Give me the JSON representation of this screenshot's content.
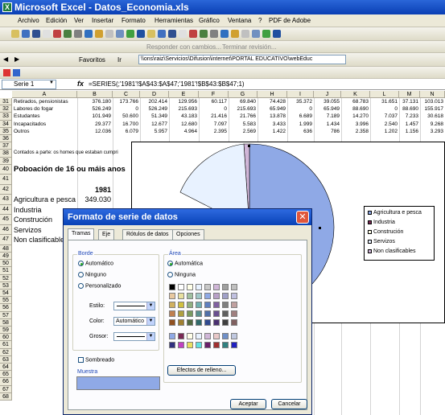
{
  "window": {
    "title": "Microsoft Excel - Datos_Economia.xls"
  },
  "menu": [
    "Archivo",
    "Edición",
    "Ver",
    "Insertar",
    "Formato",
    "Herramientas",
    "Gráfico",
    "Ventana",
    "?",
    "PDF de Adobe"
  ],
  "toolbar": {
    "reply_text": "Responder con cambios...",
    "end_review": "Terminar revisión...",
    "favorites": "Favoritos",
    "go": "Ir",
    "address": "\\\\ons\\raiz\\Servicios\\Difusion\\internet\\PORTAL EDUCATIVO\\webEduc"
  },
  "formula_bar": {
    "name_box": "Serie 1",
    "fx": "fx",
    "formula": "=SERIES(;'1981'!$A$43:$A$47;'1981'!$B$43:$B$47;1)"
  },
  "columns": [
    "A",
    "B",
    "C",
    "D",
    "E",
    "F",
    "G",
    "H",
    "I",
    "J",
    "K",
    "L",
    "M",
    "N"
  ],
  "rows": [
    {
      "num": "31",
      "label": "Retirados, pensionistas",
      "vals": [
        "376.180",
        "173.766",
        "202.414",
        "129.956",
        "60.117",
        "69.840",
        "74.428",
        "35.372",
        "39.055",
        "68.783",
        "31.651",
        "37.131",
        "103.013"
      ]
    },
    {
      "num": "32",
      "label": "Labores do fogar",
      "vals": [
        "526.249",
        "0",
        "526.249",
        "215.693",
        "0",
        "215.693",
        "65.949",
        "0",
        "65.949",
        "88.690",
        "0",
        "88.690",
        "155.917"
      ]
    },
    {
      "num": "33",
      "label": "Estudantes",
      "vals": [
        "101.949",
        "50.600",
        "51.349",
        "43.183",
        "21.416",
        "21.766",
        "13.878",
        "6.689",
        "7.189",
        "14.270",
        "7.037",
        "7.233",
        "30.618"
      ]
    },
    {
      "num": "34",
      "label": "Incapacitados",
      "vals": [
        "29.377",
        "16.700",
        "12.677",
        "12.680",
        "7.097",
        "5.583",
        "3.433",
        "1.999",
        "1.434",
        "3.996",
        "2.540",
        "1.457",
        "9.268"
      ]
    },
    {
      "num": "35",
      "label": "Outros",
      "vals": [
        "12.036",
        "6.079",
        "5.957",
        "4.964",
        "2.395",
        "2.569",
        "1.422",
        "636",
        "786",
        "2.358",
        "1.202",
        "1.156",
        "3.293"
      ]
    }
  ],
  "note_row": {
    "num": "38",
    "text": "Contados a parte: os homes que estaban cumpri"
  },
  "section_title": {
    "num": "40",
    "text": "Poboación de 16 ou máis anos"
  },
  "year_header": {
    "num": "42",
    "text": "1981"
  },
  "sector_rows": [
    {
      "num": "43",
      "label": "Agricultura e pesca",
      "value": "349.030"
    },
    {
      "num": "44",
      "label": "Industria",
      "value": ""
    },
    {
      "num": "45",
      "label": "Construción",
      "value": ""
    },
    {
      "num": "46",
      "label": "Servizos",
      "value": ""
    },
    {
      "num": "47",
      "label": "Non clasificable",
      "value": ""
    }
  ],
  "extra_row_nums": [
    "36",
    "37",
    "39",
    "41",
    "48",
    "49",
    "50",
    "51",
    "52",
    "53",
    "54",
    "55",
    "56",
    "57",
    "58",
    "59",
    "60",
    "61",
    "62",
    "63",
    "64",
    "65",
    "66",
    "67",
    "68"
  ],
  "chart_legend": [
    {
      "label": "Agricultura e pesca",
      "color": "#8fa9e6"
    },
    {
      "label": "Industria",
      "color": "#7a2a55"
    },
    {
      "label": "Construción",
      "color": "#ffffe8"
    },
    {
      "label": "Servizos",
      "color": "#e8f2ff"
    },
    {
      "label": "Non clasificables",
      "color": "#d0b6d8"
    }
  ],
  "dialog": {
    "title": "Formato de serie de datos",
    "tabs": [
      "Tramas",
      "Eje",
      "Rótulos de datos",
      "Opciones"
    ],
    "border_group": "Borde",
    "border_options": [
      "Automático",
      "Ninguno",
      "Personalizado"
    ],
    "style_label": "Estilo:",
    "color_label": "Color:",
    "color_value": "Automático",
    "weight_label": "Grosor:",
    "shadow_label": "Sombreado",
    "area_group": "Área",
    "area_options": [
      "Automática",
      "Ninguna"
    ],
    "fill_effects": "Efectos de relleno...",
    "sample_label": "Muestra",
    "ok": "Aceptar",
    "cancel": "Cancelar",
    "palette": [
      "#000000",
      "#ffffff",
      "#ffffe8",
      "#e8f2ff",
      "#c8c8c8",
      "#d0b6d8",
      "#a0a0a0",
      "#c0c0c0",
      "#e8c8a0",
      "#e8e0a0",
      "#a0c0a0",
      "#a0c8c8",
      "#8fa9e6",
      "#b8a0c8",
      "#a0a0c8",
      "#c0c0e0",
      "#d0b060",
      "#d0c040",
      "#90b080",
      "#70b0b0",
      "#6080c0",
      "#8060a0",
      "#808080",
      "#c0a0a0",
      "#c08050",
      "#b0a040",
      "#7a9a60",
      "#5a9090",
      "#5070a8",
      "#6a5090",
      "#606060",
      "#a08080",
      "#905020",
      "#a08030",
      "#506a40",
      "#306a6a",
      "#304a90",
      "#4a3070",
      "#404040",
      "#806060"
    ],
    "palette2": [
      "#8fa9e6",
      "#7a2a55",
      "#ffffe8",
      "#e8f2ff",
      "#d0b6d8",
      "#e8c8c8",
      "#7090c8",
      "#c0c8e0",
      "#303080",
      "#c040c0",
      "#e8e060",
      "#60e0e0",
      "#6a206a",
      "#a03030",
      "#308080",
      "#2020c0"
    ],
    "sample_color": "#8fa9e6"
  }
}
